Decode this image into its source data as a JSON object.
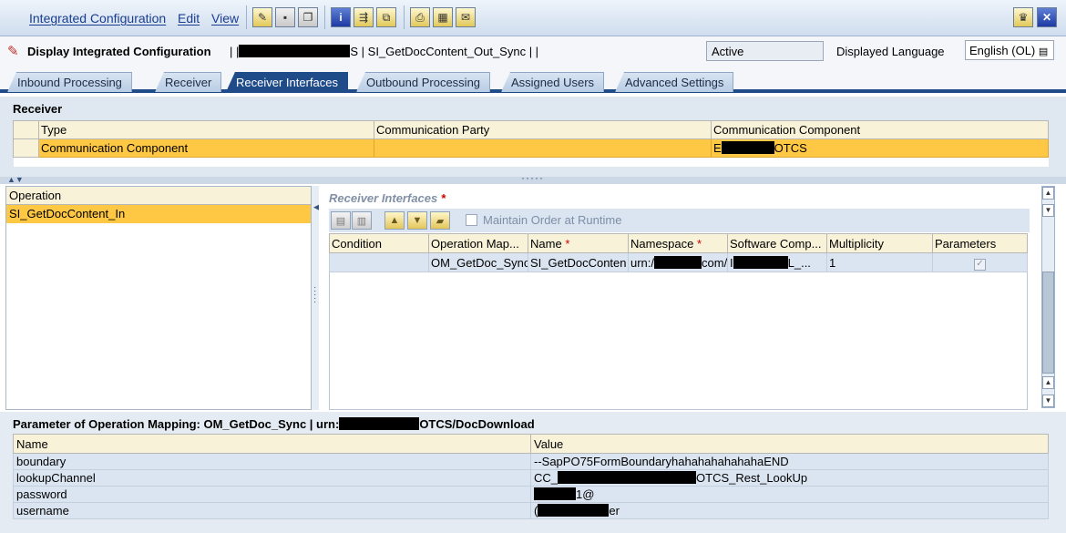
{
  "menubar": {
    "items": [
      "Integrated Configuration",
      "Edit",
      "View"
    ],
    "toolbar_icons": [
      "edit-pencil-icon",
      "save-icon",
      "copy-icon",
      "info-icon",
      "where-used-icon",
      "compare-icon",
      "print-icon",
      "table-icon",
      "notes-icon"
    ],
    "right_icons": [
      "favorites-icon",
      "close-icon"
    ]
  },
  "title": {
    "text": "Display Integrated Configuration",
    "breadcrumb_prefix": "| |",
    "breadcrumb_mid": "S | SI_GetDocContent_Out_Sync | |",
    "status": "Active",
    "language_label": "Displayed Language",
    "language_value": "English (OL)"
  },
  "tabs": [
    {
      "label": "Inbound Processing",
      "active": false
    },
    {
      "label": "Receiver",
      "active": false
    },
    {
      "label": "Receiver Interfaces",
      "active": true
    },
    {
      "label": "Outbound Processing",
      "active": false
    },
    {
      "label": "Assigned Users",
      "active": false
    },
    {
      "label": "Advanced Settings",
      "active": false
    }
  ],
  "receiver": {
    "heading": "Receiver",
    "columns": [
      "Type",
      "Communication Party",
      "Communication Component"
    ],
    "row": {
      "type": "Communication Component",
      "party": "",
      "component_prefix": "E",
      "component_suffix": "OTCS"
    }
  },
  "operation": {
    "header": "Operation",
    "selected": "SI_GetDocContent_In"
  },
  "receiver_interfaces": {
    "heading": "Receiver Interfaces",
    "required_mark": "*",
    "maintain_order_label": "Maintain Order at Runtime",
    "columns": [
      "Condition",
      "Operation Map...",
      "Name",
      "Namespace",
      "Software Comp...",
      "Multiplicity",
      "Parameters"
    ],
    "row": {
      "condition": "",
      "operation_mapping": "OM_GetDoc_Sync",
      "name": "SI_GetDocConten",
      "namespace_prefix": "urn:/",
      "namespace_suffix": "com/I",
      "software_prefix": "I",
      "software_suffix": "L_...",
      "multiplicity": "1"
    }
  },
  "parameters": {
    "heading_prefix": "Parameter of Operation Mapping: OM_GetDoc_Sync | urn:",
    "heading_suffix": "OTCS/DocDownload",
    "columns": [
      "Name",
      "Value"
    ],
    "rows": [
      {
        "name": "boundary",
        "value_prefix": "--SapPO75FormBoundaryhahahahahahahaEND",
        "value_suffix": ""
      },
      {
        "name": "lookupChannel",
        "value_prefix": "CC_",
        "value_suffix": "OTCS_Rest_LookUp"
      },
      {
        "name": "password",
        "value_prefix": "",
        "value_suffix": "1@"
      },
      {
        "name": "username",
        "value_prefix": "(",
        "value_suffix": "er"
      }
    ]
  },
  "colors": {
    "selected_row": "#fec844",
    "tab_active": "#1f4b89",
    "header_bg": "#f8f2d8",
    "panel_bg": "#dfe7f1"
  }
}
